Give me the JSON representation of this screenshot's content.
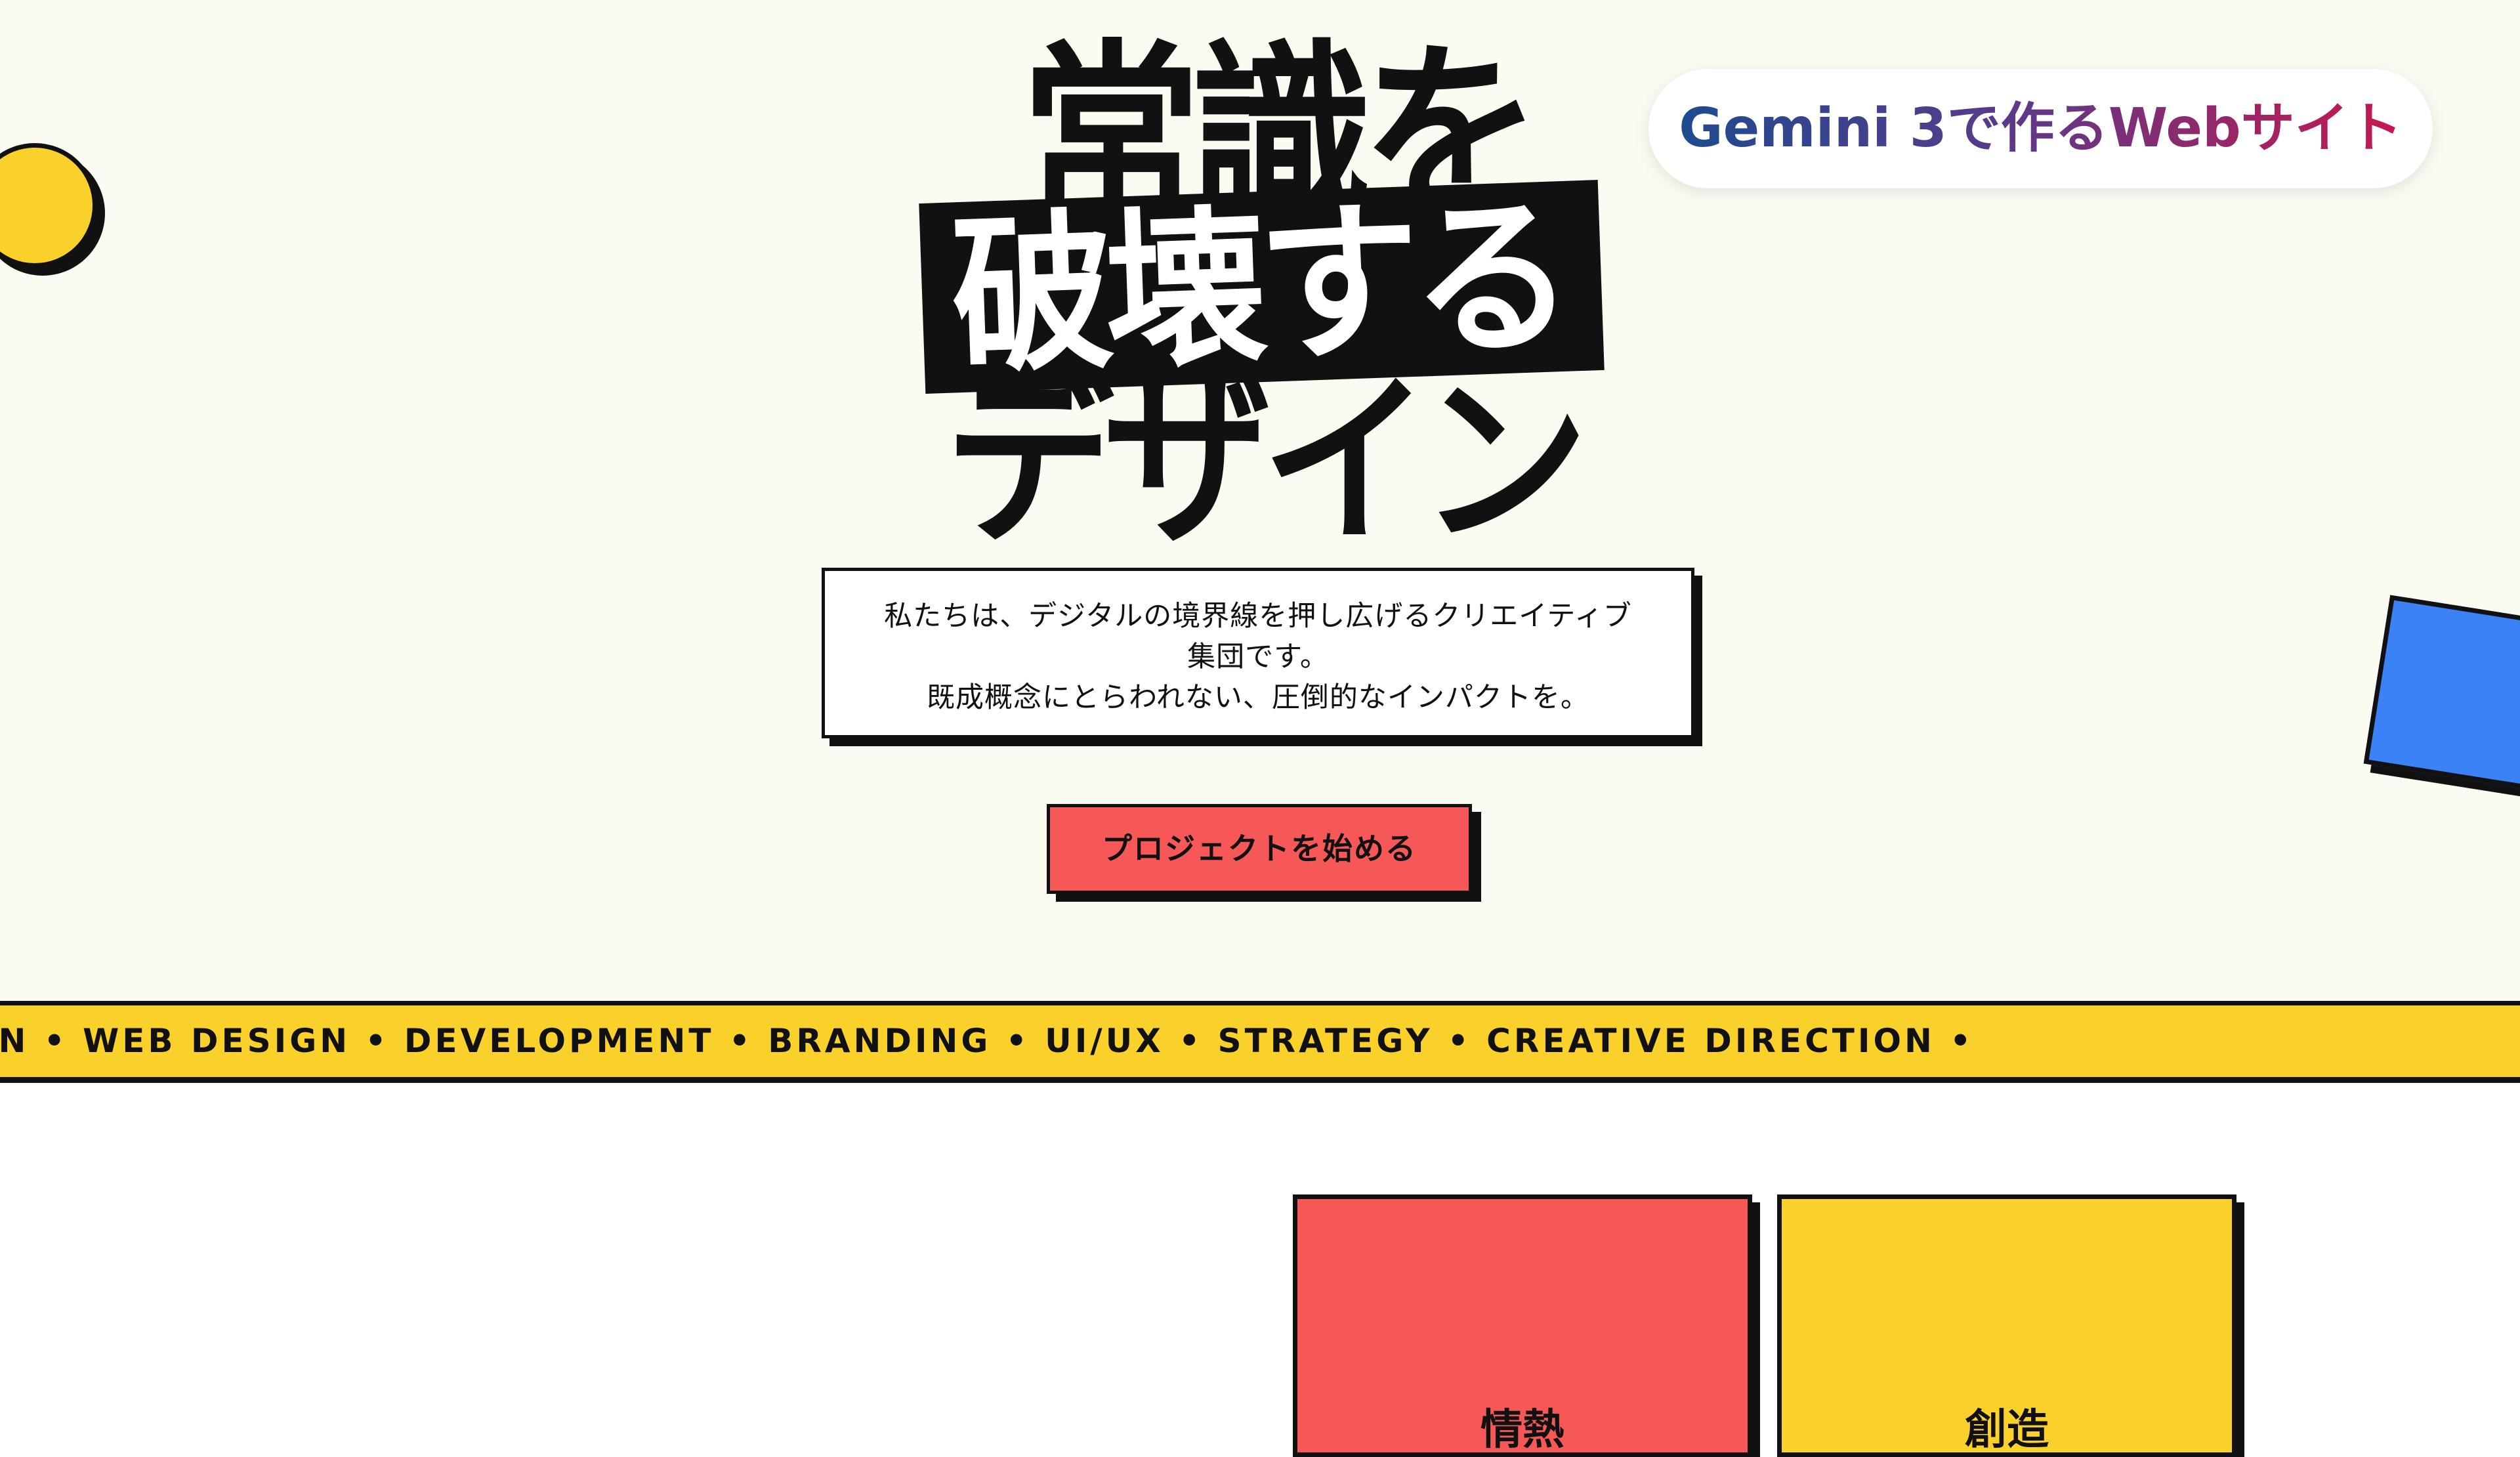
{
  "hero": {
    "title_line_1": "常識を",
    "title_line_2": "破壊する",
    "title_line_3": "デザイン",
    "description_line_1": "私たちは、デジタルの境界線を押し広げるクリエイティブ",
    "description_line_2": "集団です。",
    "description_line_3": "既成概念にとらわれない、圧倒的なインパクトを。",
    "cta_label": "プロジェクトを始める"
  },
  "badge": {
    "text": "Gemini 3で作るWebサイト"
  },
  "marquee": {
    "text": "ON • WEB DESIGN • DEVELOPMENT • BRANDING • UI/UX • STRATEGY • CREATIVE DIRECTION •"
  },
  "cards": [
    {
      "label": "情熱"
    },
    {
      "label": "創造"
    }
  ],
  "colors": {
    "background": "#fbfbf2",
    "ink": "#111111",
    "red": "#f65757",
    "yellow": "#fad02b",
    "blue": "#3b82f6"
  }
}
